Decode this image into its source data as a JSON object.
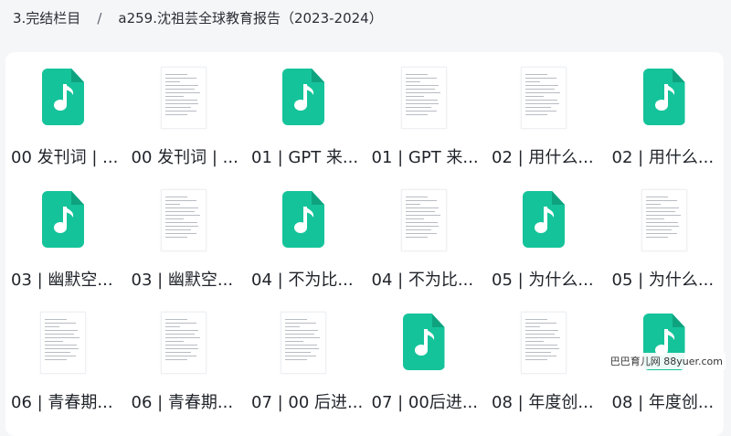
{
  "breadcrumb": {
    "parent": "3.完结栏目",
    "separator": "/",
    "current": "a259.沈祖芸全球教育报告（2023-2024）"
  },
  "files": [
    {
      "label": "00 发刊词 | ...",
      "type": "audio"
    },
    {
      "label": "00 发刊词 | ...",
      "type": "document"
    },
    {
      "label": "01 | GPT 来...",
      "type": "audio"
    },
    {
      "label": "01 | GPT 来...",
      "type": "document"
    },
    {
      "label": "02 | 用什么...",
      "type": "document"
    },
    {
      "label": "02 | 用什么...",
      "type": "audio"
    },
    {
      "label": "03 | 幽默空...",
      "type": "audio"
    },
    {
      "label": "03 | 幽默空...",
      "type": "document"
    },
    {
      "label": "04 | 不为比...",
      "type": "audio"
    },
    {
      "label": "04 | 不为比...",
      "type": "document"
    },
    {
      "label": "05 | 为什么...",
      "type": "audio"
    },
    {
      "label": "05 | 为什么...",
      "type": "document"
    },
    {
      "label": "06 | 青春期...",
      "type": "document"
    },
    {
      "label": "06 | 青春期...",
      "type": "document"
    },
    {
      "label": "07 | 00 后进...",
      "type": "document"
    },
    {
      "label": "07 | 00后进...",
      "type": "audio"
    },
    {
      "label": "08 | 年度创...",
      "type": "document"
    },
    {
      "label": "08 | 年度创...",
      "type": "audio"
    }
  ],
  "watermark": "巴巴育儿网 88yuer.com",
  "icons": {
    "audio": "music-file-icon",
    "document": "document-thumbnail-icon"
  },
  "colors": {
    "accent": "#15c39a",
    "background": "#f5f6f8",
    "panel": "#ffffff"
  }
}
